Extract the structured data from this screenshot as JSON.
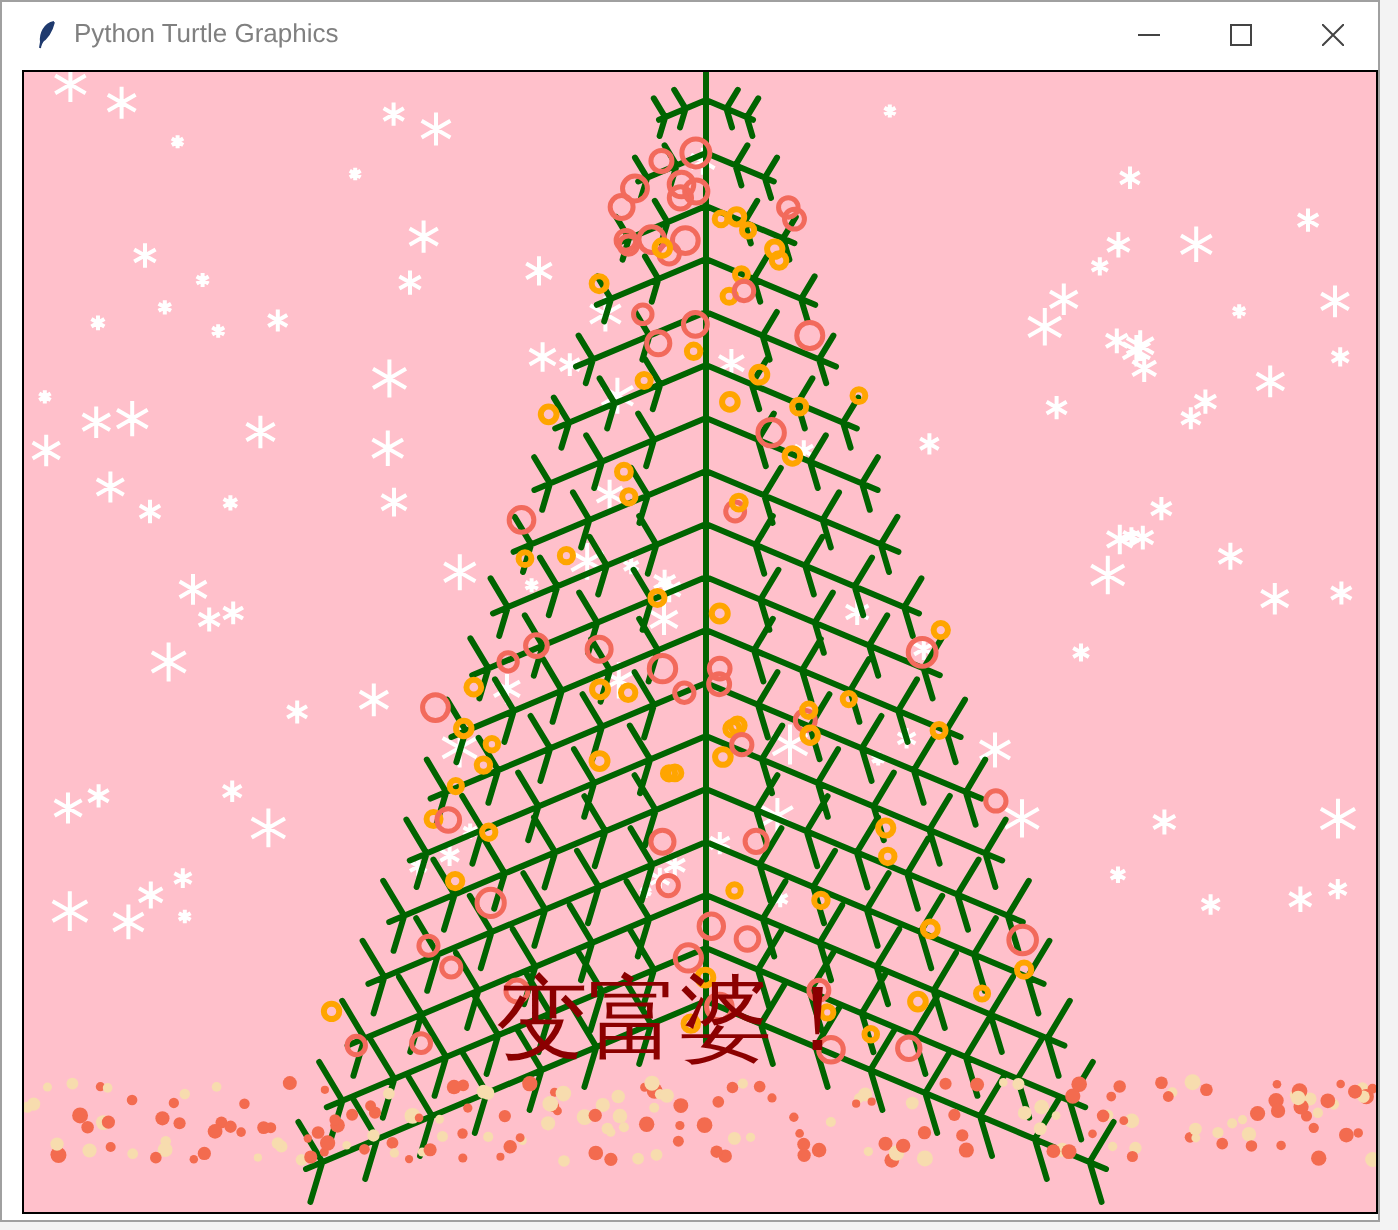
{
  "window": {
    "title": "Python Turtle Graphics"
  },
  "canvas": {
    "caption": "变富婆！"
  }
}
